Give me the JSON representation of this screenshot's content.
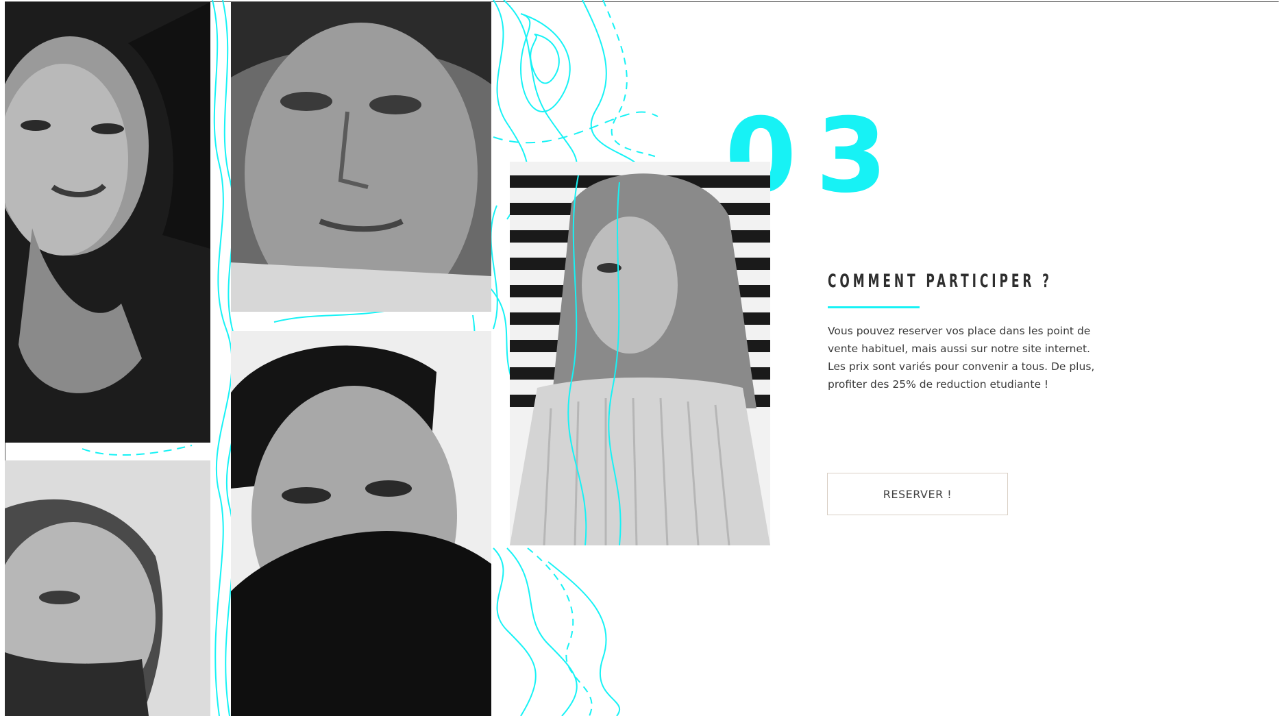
{
  "section": {
    "number": "03",
    "heading": "Comment participer ?",
    "paragraphs": [
      "Vous pouvez reserver vos place dans les point de vente habituel, mais aussi sur notre site internet.",
      "Les prix sont variés pour convenir a tous. De plus, profiter des 25% de reduction etudiante !"
    ],
    "cta_label": "RESERVER !"
  },
  "colors": {
    "accent": "#17f2f5",
    "text": "#3a3a3a",
    "button_border": "#d9cfc4"
  },
  "photos": [
    {
      "name": "portrait-woman-dark",
      "tone": "dark"
    },
    {
      "name": "portrait-man-closeup",
      "tone": "mid"
    },
    {
      "name": "portrait-man-beard",
      "tone": "light"
    },
    {
      "name": "portrait-man-scarf",
      "tone": "light"
    },
    {
      "name": "portrait-woman-sweater",
      "tone": "mid"
    }
  ]
}
